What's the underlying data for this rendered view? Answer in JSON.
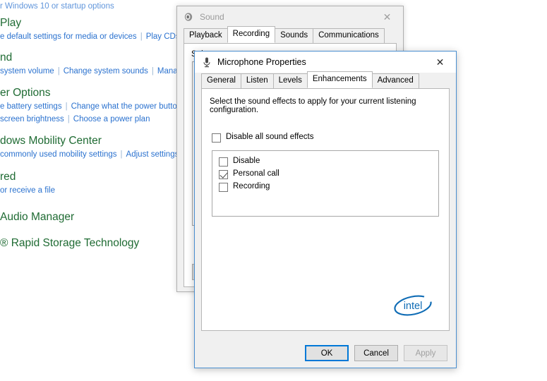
{
  "control_panel": {
    "clipped_top_line": "r Windows 10 or startup options",
    "groups": [
      {
        "heading": "Play",
        "links": [
          "e default settings for media or devices",
          "Play CDs or o"
        ]
      },
      {
        "heading": "nd",
        "links": [
          "system volume",
          "Change system sounds",
          "Manage"
        ]
      },
      {
        "heading": "er Options",
        "links": [
          "e battery settings",
          "Change what the power buttons d",
          "screen brightness",
          "Choose a power plan"
        ],
        "rows": [
          [
            "e battery settings",
            "Change what the power buttons d"
          ],
          [
            "screen brightness",
            "Choose a power plan"
          ]
        ]
      },
      {
        "heading": "dows Mobility Center",
        "links": [
          "commonly used mobility settings",
          "Adjust settings be"
        ]
      },
      {
        "heading": "red",
        "links": [
          "or receive a file"
        ]
      },
      {
        "heading": "Audio Manager",
        "links": []
      },
      {
        "heading": "® Rapid Storage Technology",
        "links": []
      }
    ]
  },
  "sound_dialog": {
    "title": "Sound",
    "title_icon": "speaker-icon",
    "close_label": "✕",
    "tabs": [
      {
        "label": "Playback",
        "selected": false
      },
      {
        "label": "Recording",
        "selected": true
      },
      {
        "label": "Sounds",
        "selected": false
      },
      {
        "label": "Communications",
        "selected": false
      }
    ],
    "instruction": "Sel",
    "device_item_icon": "microphone-device-icon",
    "buttons": [
      "",
      ""
    ]
  },
  "mic_dialog": {
    "title": "Microphone Properties",
    "title_icon": "microphone-icon",
    "close_label": "✕",
    "tabs": [
      {
        "label": "General",
        "selected": false
      },
      {
        "label": "Listen",
        "selected": false
      },
      {
        "label": "Levels",
        "selected": false
      },
      {
        "label": "Enhancements",
        "selected": true
      },
      {
        "label": "Advanced",
        "selected": false
      }
    ],
    "description": "Select the sound effects to apply for your current listening configuration.",
    "disable_all": {
      "label": "Disable all sound effects",
      "checked": false
    },
    "effects": [
      {
        "label": "Disable",
        "checked": false
      },
      {
        "label": "Personal call",
        "checked": true
      },
      {
        "label": "Recording",
        "checked": false
      }
    ],
    "brand_logo": "intel-logo",
    "brand_text": "intel",
    "buttons": [
      {
        "label": "OK",
        "state": "default"
      },
      {
        "label": "Cancel",
        "state": "normal"
      },
      {
        "label": "Apply",
        "state": "disabled"
      }
    ]
  },
  "colors": {
    "heading_green": "#1f6b33",
    "link_blue": "#2b72cf",
    "accent_blue": "#0078d7",
    "intel_blue": "#0f6cb5",
    "active_border": "#4a8fd0",
    "dialog_bg": "#f0f0f0"
  }
}
